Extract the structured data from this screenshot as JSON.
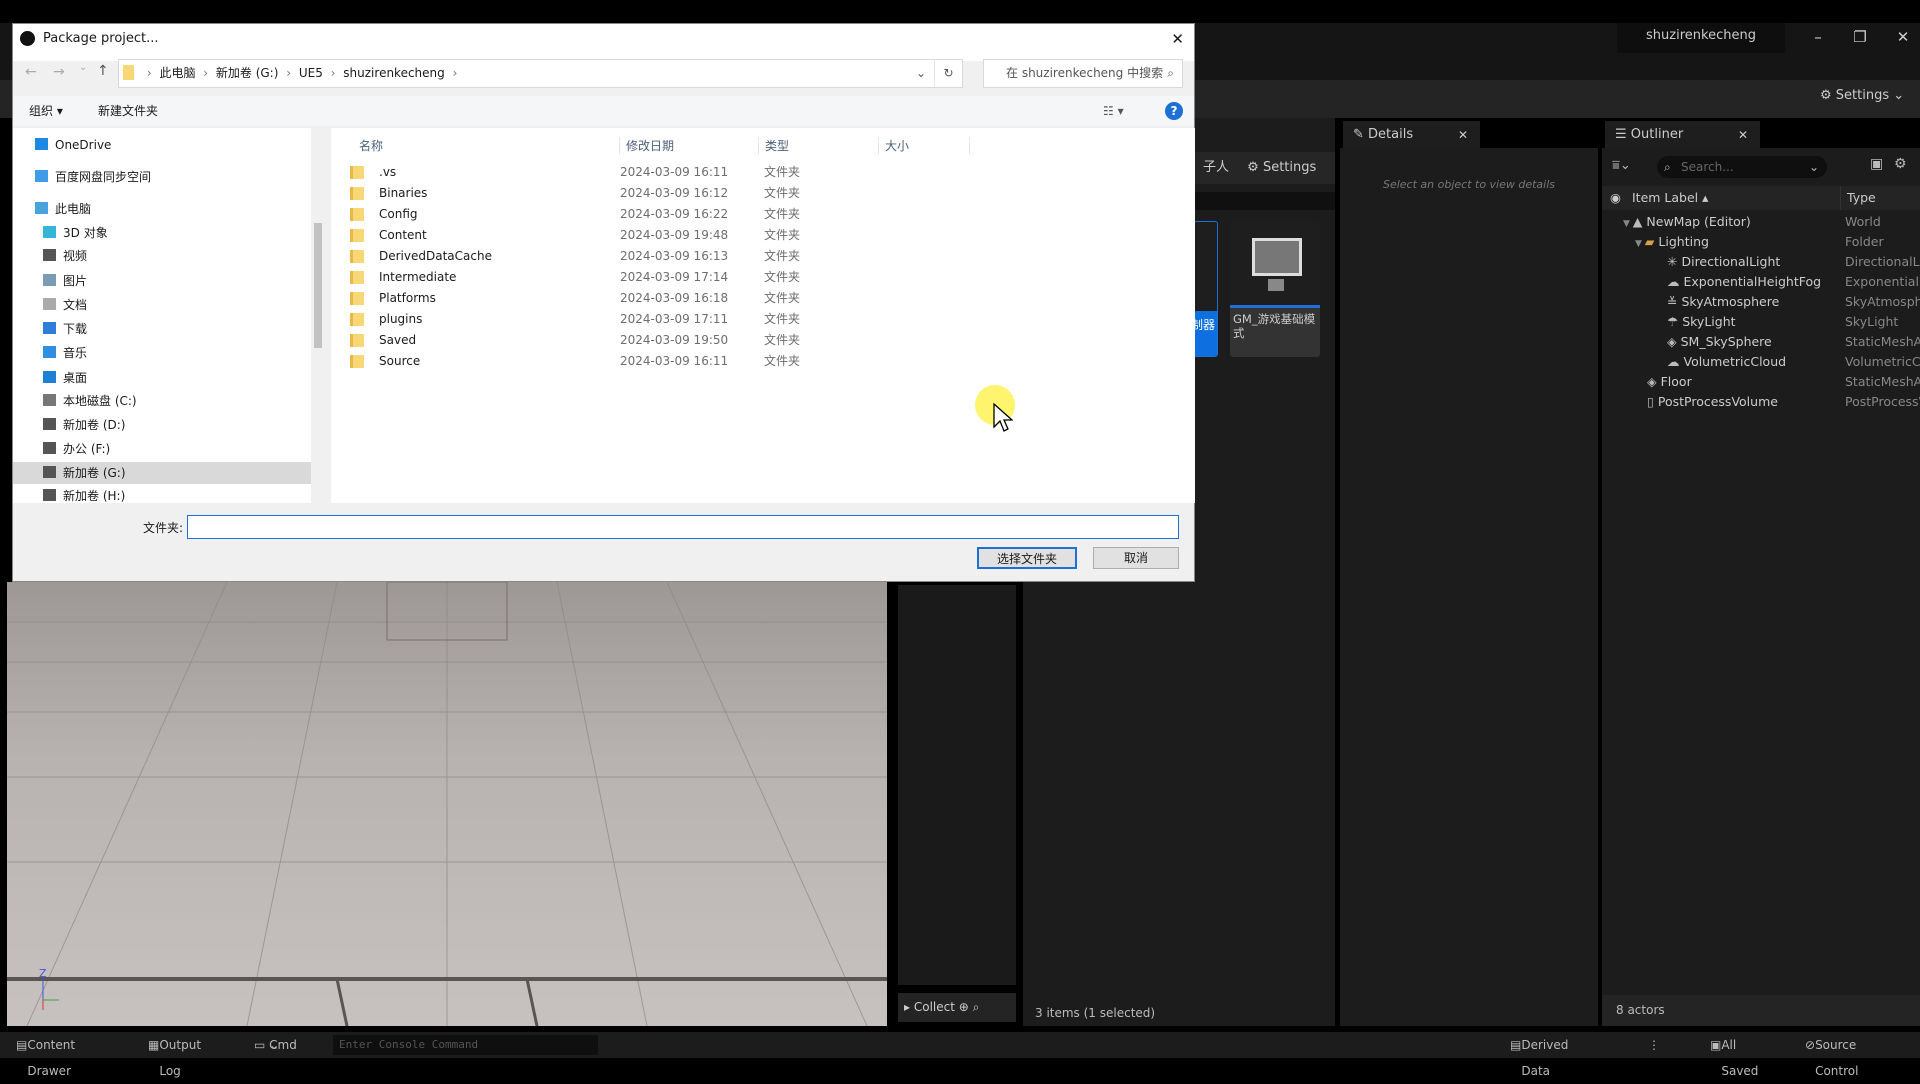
{
  "ue": {
    "project_tab": "shuzirenkecheng",
    "toolbar_settings": "Settings",
    "content_settings": "Settings",
    "content_partial_label": "子人",
    "asset_tiles": [
      {
        "label": "...制器",
        "selected": true
      },
      {
        "label": "GM_游戏基础模式",
        "selected": false
      }
    ],
    "collections_label": "Collect",
    "items_count": "3 items (1 selected)",
    "details": {
      "tab": "Details",
      "empty_text": "Select an object to view details"
    },
    "outliner": {
      "tab": "Outliner",
      "search_placeholder": "Search...",
      "col_label": "Item Label",
      "col_type": "Type",
      "rows": [
        {
          "label": "NewMap (Editor)",
          "type": "World",
          "depth": 0,
          "icon": "world-icon"
        },
        {
          "label": "Lighting",
          "type": "Folder",
          "depth": 1,
          "icon": "folder-icon"
        },
        {
          "label": "DirectionalLight",
          "type": "DirectionalLight",
          "depth": 2,
          "icon": "directional-light-icon"
        },
        {
          "label": "ExponentialHeightFog",
          "type": "ExponentialHeightFog",
          "depth": 2,
          "icon": "fog-icon"
        },
        {
          "label": "SkyAtmosphere",
          "type": "SkyAtmosphere",
          "depth": 2,
          "icon": "sky-atmosphere-icon"
        },
        {
          "label": "SkyLight",
          "type": "SkyLight",
          "depth": 2,
          "icon": "skylight-icon"
        },
        {
          "label": "SM_SkySphere",
          "type": "StaticMeshActor",
          "depth": 2,
          "icon": "static-mesh-icon"
        },
        {
          "label": "VolumetricCloud",
          "type": "VolumetricCloud",
          "depth": 2,
          "icon": "cloud-icon"
        },
        {
          "label": "Floor",
          "type": "StaticMeshActor",
          "depth": 1,
          "icon": "static-mesh-icon"
        },
        {
          "label": "PostProcessVolume",
          "type": "PostProcessVolume",
          "depth": 1,
          "icon": "volume-icon"
        }
      ],
      "actors_count": "8 actors"
    },
    "status": {
      "content_drawer": "Content Drawer",
      "output_log": "Output Log",
      "cmd": "Cmd",
      "console_placeholder": "Enter Console Command",
      "derived_data": "Derived Data",
      "all_saved": "All Saved",
      "source_control": "Source Control"
    }
  },
  "dialog": {
    "title": "Package project...",
    "breadcrumb": [
      "此电脑",
      "新加卷 (G:)",
      "UE5",
      "shuzirenkecheng"
    ],
    "search_placeholder": "在 shuzirenkecheng 中搜索",
    "organize": "组织 ▾",
    "new_folder": "新建文件夹",
    "sidebar": [
      {
        "label": "OneDrive",
        "icon": "onedrive-icon",
        "indent": 0,
        "color": "#1e88e5"
      },
      {
        "label": "百度网盘同步空间",
        "icon": "baidu-netdisk-icon",
        "indent": 0,
        "color": "#3d9be9"
      },
      {
        "label": "此电脑",
        "icon": "computer-icon",
        "indent": 0,
        "color": "#4aa3df"
      },
      {
        "label": "3D 对象",
        "icon": "3d-objects-icon",
        "indent": 1,
        "color": "#35b6d9"
      },
      {
        "label": "视频",
        "icon": "video-icon",
        "indent": 1,
        "color": "#555"
      },
      {
        "label": "图片",
        "icon": "pictures-icon",
        "indent": 1,
        "color": "#7a9cb5"
      },
      {
        "label": "文档",
        "icon": "documents-icon",
        "indent": 1,
        "color": "#aaa"
      },
      {
        "label": "下载",
        "icon": "download-icon",
        "indent": 1,
        "color": "#2f7fd8"
      },
      {
        "label": "音乐",
        "icon": "music-icon",
        "indent": 1,
        "color": "#2f8fe0"
      },
      {
        "label": "桌面",
        "icon": "desktop-icon",
        "indent": 1,
        "color": "#1e7fd6"
      },
      {
        "label": "本地磁盘 (C:)",
        "icon": "drive-icon",
        "indent": 1,
        "color": "#777"
      },
      {
        "label": "新加卷 (D:)",
        "icon": "drive-icon",
        "indent": 1,
        "color": "#555"
      },
      {
        "label": "办公 (F:)",
        "icon": "drive-icon",
        "indent": 1,
        "color": "#555"
      },
      {
        "label": "新加卷 (G:)",
        "icon": "drive-icon",
        "indent": 1,
        "color": "#555",
        "selected": true
      },
      {
        "label": "新加卷 (H:)",
        "icon": "drive-icon",
        "indent": 1,
        "color": "#555"
      }
    ],
    "columns": [
      "名称",
      "修改日期",
      "类型",
      "大小"
    ],
    "files": [
      {
        "name": ".vs",
        "date": "2024-03-09 16:11",
        "type": "文件夹"
      },
      {
        "name": "Binaries",
        "date": "2024-03-09 16:12",
        "type": "文件夹"
      },
      {
        "name": "Config",
        "date": "2024-03-09 16:22",
        "type": "文件夹"
      },
      {
        "name": "Content",
        "date": "2024-03-09 19:48",
        "type": "文件夹"
      },
      {
        "name": "DerivedDataCache",
        "date": "2024-03-09 16:13",
        "type": "文件夹"
      },
      {
        "name": "Intermediate",
        "date": "2024-03-09 17:14",
        "type": "文件夹"
      },
      {
        "name": "Platforms",
        "date": "2024-03-09 16:18",
        "type": "文件夹"
      },
      {
        "name": "plugins",
        "date": "2024-03-09 17:11",
        "type": "文件夹"
      },
      {
        "name": "Saved",
        "date": "2024-03-09 19:50",
        "type": "文件夹"
      },
      {
        "name": "Source",
        "date": "2024-03-09 16:11",
        "type": "文件夹"
      }
    ],
    "folder_label": "文件夹:",
    "folder_value": "",
    "select_button": "选择文件夹",
    "cancel_button": "取消"
  }
}
